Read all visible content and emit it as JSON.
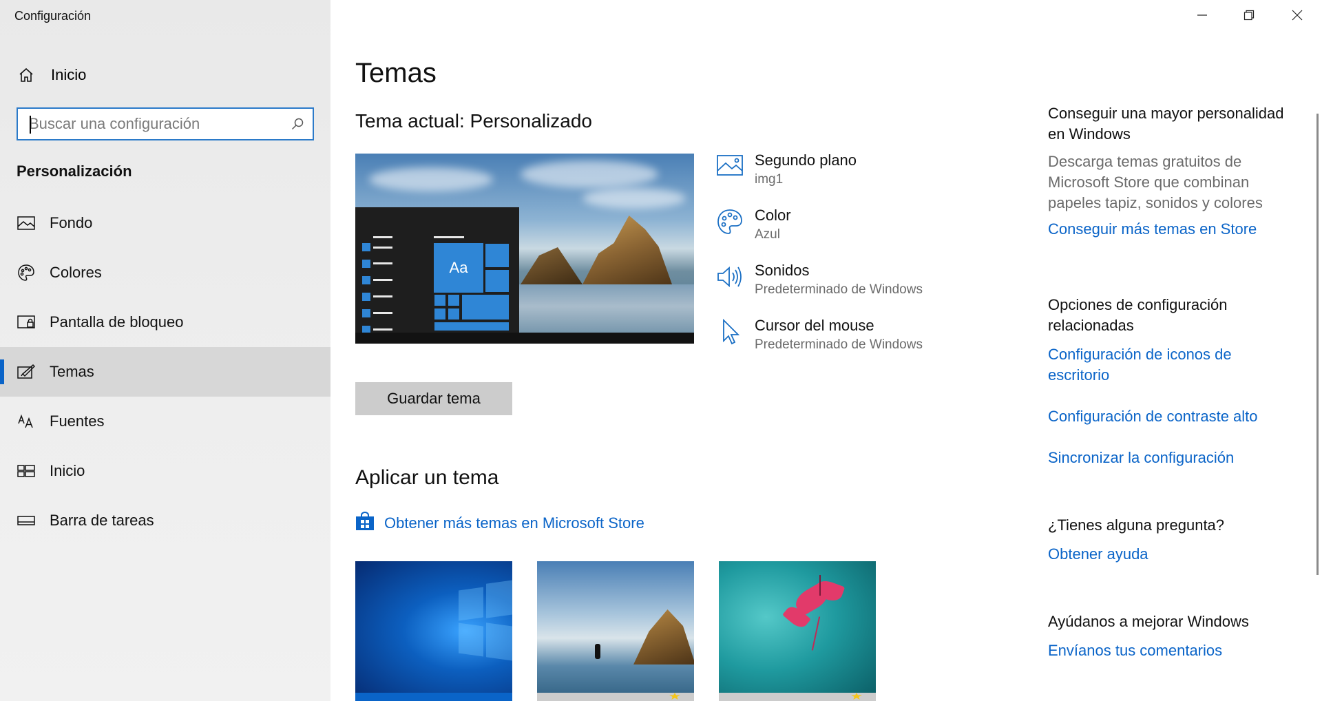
{
  "window": {
    "title": "Configuración",
    "controls": {
      "minimize": "minimize-icon",
      "restore": "restore-icon",
      "close": "close-icon"
    }
  },
  "sidebar": {
    "home_label": "Inicio",
    "search": {
      "placeholder": "Buscar una configuración"
    },
    "section_title": "Personalización",
    "items": [
      {
        "label": "Fondo",
        "icon": "picture-icon",
        "selected": false
      },
      {
        "label": "Colores",
        "icon": "palette-icon",
        "selected": false
      },
      {
        "label": "Pantalla de bloqueo",
        "icon": "lock-screen-icon",
        "selected": false
      },
      {
        "label": "Temas",
        "icon": "themes-brush-icon",
        "selected": true
      },
      {
        "label": "Fuentes",
        "icon": "font-icon",
        "selected": false
      },
      {
        "label": "Inicio",
        "icon": "start-layout-icon",
        "selected": false
      },
      {
        "label": "Barra de tareas",
        "icon": "taskbar-icon",
        "selected": false
      }
    ]
  },
  "main": {
    "title": "Temas",
    "current_theme": "Tema actual: Personalizado",
    "preview": {
      "tile_label": "Aa"
    },
    "properties": [
      {
        "title": "Segundo plano",
        "value": "img1",
        "icon": "picture-icon"
      },
      {
        "title": "Color",
        "value": "Azul",
        "icon": "palette-icon"
      },
      {
        "title": "Sonidos",
        "value": "Predeterminado de Windows",
        "icon": "speaker-icon"
      },
      {
        "title": "Cursor del mouse",
        "value": "Predeterminado de Windows",
        "icon": "cursor-icon"
      }
    ],
    "save_button": "Guardar tema",
    "apply_title": "Aplicar un tema",
    "store_link": "Obtener más temas en Microsoft Store"
  },
  "right": {
    "more_heading": "Conseguir una mayor personalidad en Windows",
    "more_desc": "Descarga temas gratuitos de Microsoft Store que combinan papeles tapiz, sonidos y colores",
    "more_link": "Conseguir más temas en Store",
    "related_heading": "Opciones de configuración relacionadas",
    "related_links": [
      "Configuración de iconos de escritorio",
      "Configuración de contraste alto",
      "Sincronizar la configuración"
    ],
    "question_heading": "¿Tienes alguna pregunta?",
    "question_link": "Obtener ayuda",
    "improve_heading": "Ayúdanos a mejorar Windows",
    "improve_link": "Envíanos tus comentarios"
  },
  "colors": {
    "accent": "#0a64c8",
    "selected_bg": "#d7d7d7",
    "sidebar_bg": "#eeeeee"
  }
}
